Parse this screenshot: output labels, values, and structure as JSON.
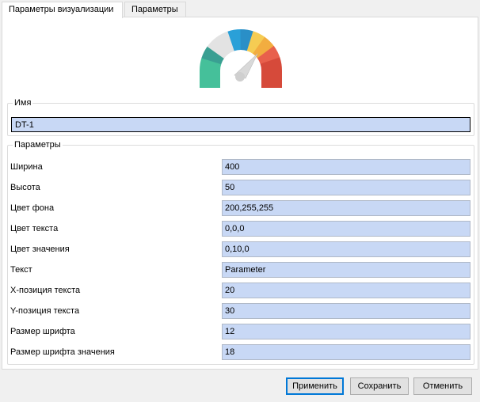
{
  "tabs": [
    {
      "label": "Параметры визуализации",
      "active": true
    },
    {
      "label": "Параметры",
      "active": false
    }
  ],
  "gauge": {
    "icon": "gauge-icon",
    "colors": [
      "#45c09a",
      "#3a9f92",
      "#e3e3e3",
      "#e3e3e3",
      "#2aa0d8",
      "#2a8fc7",
      "#f5cc53",
      "#f2ad40",
      "#e8604c",
      "#d64a3a"
    ]
  },
  "name_group": {
    "title": "Имя",
    "value": "DT-1"
  },
  "params_group": {
    "title": "Параметры",
    "rows": [
      {
        "label": "Ширина",
        "value": "400"
      },
      {
        "label": "Высота",
        "value": "50"
      },
      {
        "label": "Цвет фона",
        "value": "200,255,255"
      },
      {
        "label": "Цвет текста",
        "value": "0,0,0"
      },
      {
        "label": "Цвет значения",
        "value": "0,10,0"
      },
      {
        "label": "Текст",
        "value": "Parameter"
      },
      {
        "label": "X-позиция текста",
        "value": "20"
      },
      {
        "label": "Y-позиция текста",
        "value": "30"
      },
      {
        "label": "Размер шрифта",
        "value": "12"
      },
      {
        "label": "Размер шрифта значения",
        "value": "18"
      }
    ]
  },
  "buttons": {
    "apply": "Применить",
    "save": "Сохранить",
    "cancel": "Отменить"
  }
}
